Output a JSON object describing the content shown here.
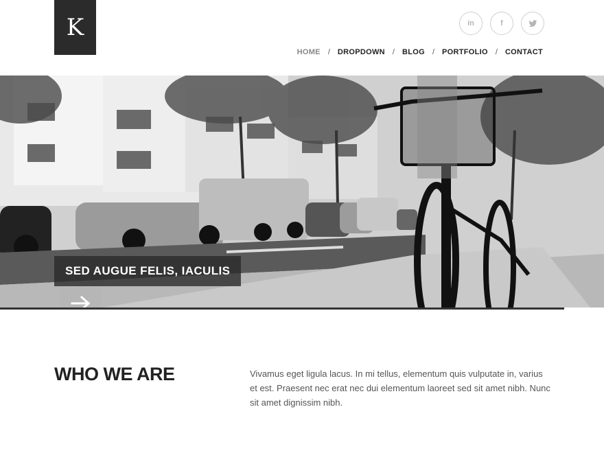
{
  "logo": {
    "letter": "K"
  },
  "social": [
    {
      "label": "in",
      "icon": "linkedin-icon"
    },
    {
      "label": "f",
      "icon": "facebook-icon"
    },
    {
      "label": "",
      "icon": "twitter-icon"
    }
  ],
  "nav": {
    "items": [
      "HOME",
      "DROPDOWN",
      "BLOG",
      "PORTFOLIO",
      "CONTACT"
    ],
    "separator": "/"
  },
  "hero": {
    "caption": "SED AUGUE FELIS, IACULIS",
    "arrow_icon": "arrow-right-icon"
  },
  "who": {
    "title": "WHO WE ARE",
    "text": "Vivamus eget ligula lacus. In mi tellus, elementum quis vulputate in, varius et est. Praesent nec erat nec dui elementum laoreet sed sit amet nibh. Nunc sit amet dignissim nibh."
  },
  "colors": {
    "logo_bg": "#2b2b2b",
    "nav_active": "#888888",
    "text_dark": "#222222"
  }
}
